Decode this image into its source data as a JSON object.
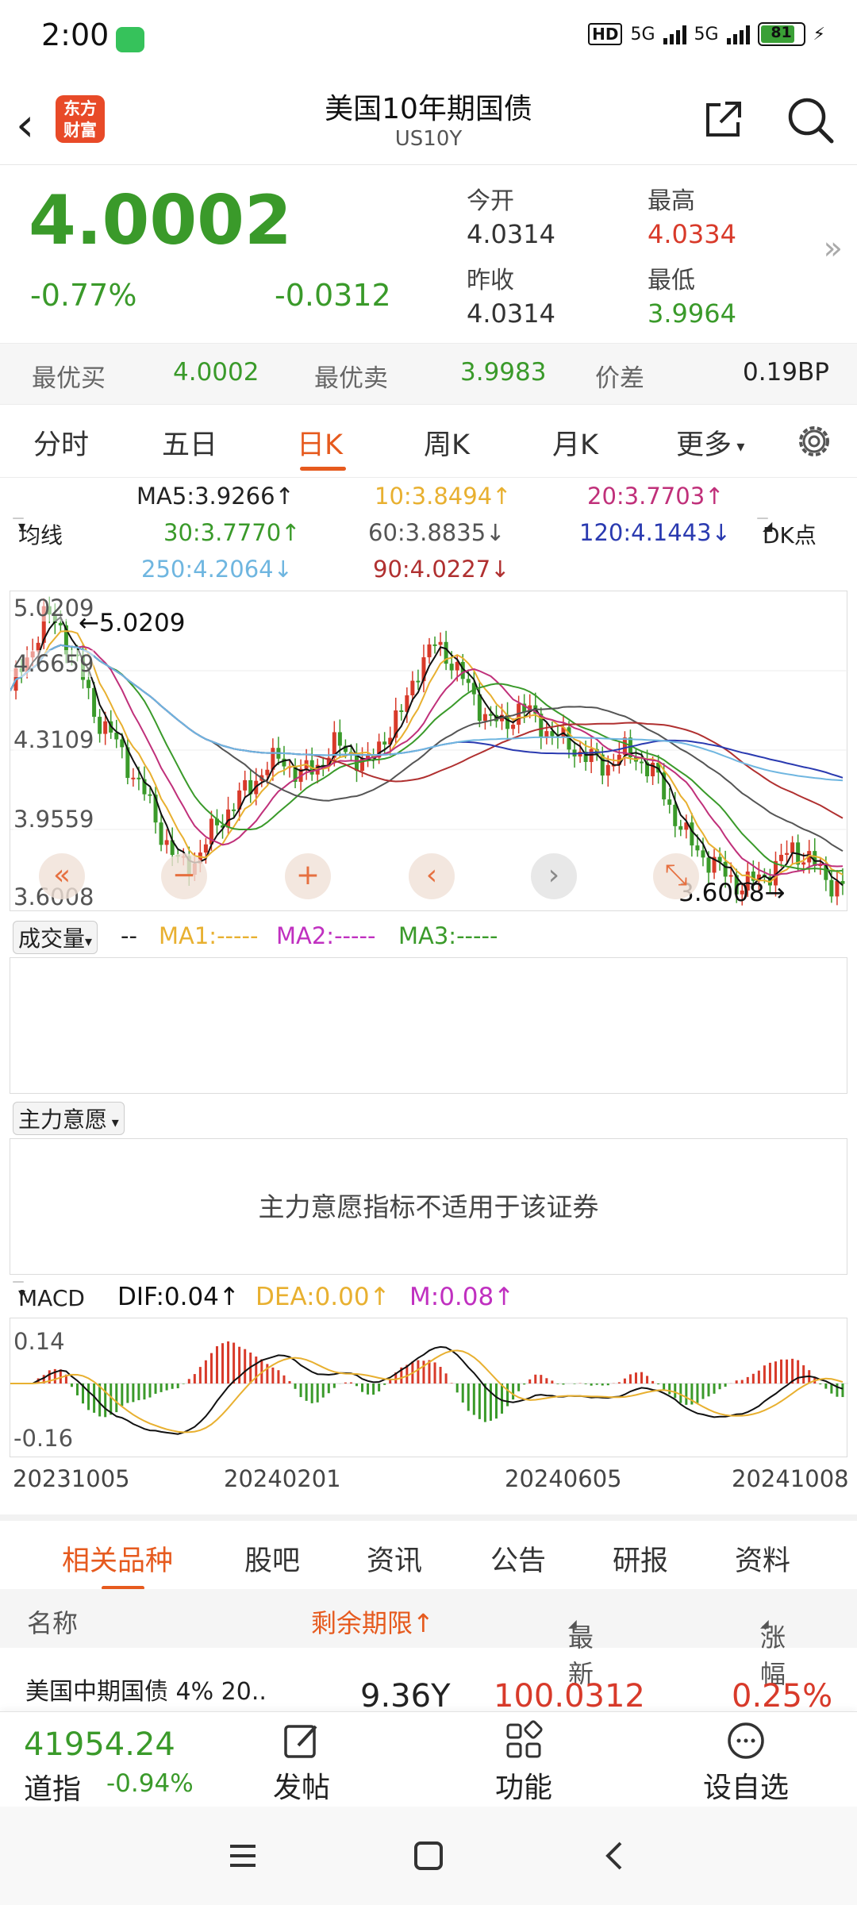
{
  "status_bar": {
    "time": "2:00",
    "battery": "81",
    "hd_label": "HD",
    "net1": "5G",
    "net2": "5G"
  },
  "header": {
    "title": "美国10年期国债",
    "subtitle": "US10Y",
    "logo_text": "东方\n财富"
  },
  "quote": {
    "price": "4.0002",
    "change_pct": "-0.77%",
    "change_val": "-0.0312",
    "open_label": "今开",
    "open": "4.0314",
    "high_label": "最高",
    "high": "4.0334",
    "prev_close_label": "昨收",
    "prev_close": "4.0314",
    "low_label": "最低",
    "low": "3.9964"
  },
  "bid_ask": {
    "bid_label": "最优买",
    "bid": "4.0002",
    "ask_label": "最优卖",
    "ask": "3.9983",
    "spread_label": "价差",
    "spread": "0.19BP"
  },
  "period_tabs": [
    "分时",
    "五日",
    "日K",
    "周K",
    "月K",
    "更多"
  ],
  "active_period": "日K",
  "ma_legend": {
    "selector": "均线",
    "dk_button": "DK点",
    "ma5": "MA5:3.9266↑",
    "ma10": "10:3.8494↑",
    "ma20": "20:3.7703↑",
    "ma30": "30:3.7770↑",
    "ma60": "60:3.8835↓",
    "ma120": "120:4.1443↓",
    "ma250": "250:4.2064↓",
    "ma90": "90:4.0227↓"
  },
  "kchart": {
    "y_labels": [
      "5.0209",
      "4.6659",
      "4.3109",
      "3.9559",
      "3.6008"
    ],
    "high_marker": "5.0209",
    "low_marker": "3.6008",
    "controls": [
      "«",
      "−",
      "+",
      "‹",
      "›",
      "⤡"
    ]
  },
  "volume": {
    "selector": "成交量",
    "dash": "--",
    "ma1": "MA1:-----",
    "ma2": "MA2:-----",
    "ma3": "MA3:-----"
  },
  "intent": {
    "selector": "主力意愿",
    "message": "主力意愿指标不适用于该证券"
  },
  "macd": {
    "selector": "MACD",
    "dif": "DIF:0.04↑",
    "dea": "DEA:0.00↑",
    "m": "M:0.08↑",
    "y_top": "0.14",
    "y_bottom": "-0.16"
  },
  "dates": [
    "20231005",
    "20240201",
    "20240605",
    "20241008"
  ],
  "bottom_tabs": [
    "相关品种",
    "股吧",
    "资讯",
    "公告",
    "研报",
    "资料"
  ],
  "table": {
    "headers": {
      "name": "名称",
      "term": "剩余期限↑",
      "latest": "最新",
      "change": "涨幅"
    },
    "rows": [
      {
        "name": "美国中期国债 4% 20..",
        "term": "9.36Y",
        "latest": "100.0312",
        "change": "0.25%"
      }
    ]
  },
  "bottom_bar": {
    "index_value": "41954.24",
    "index_name": "道指",
    "index_change": "-0.94%",
    "post": "发帖",
    "features": "功能",
    "watchlist": "设自选"
  },
  "colors": {
    "up": "#d83a2a",
    "down": "#3a9a2a",
    "accent": "#e65a1e"
  }
}
